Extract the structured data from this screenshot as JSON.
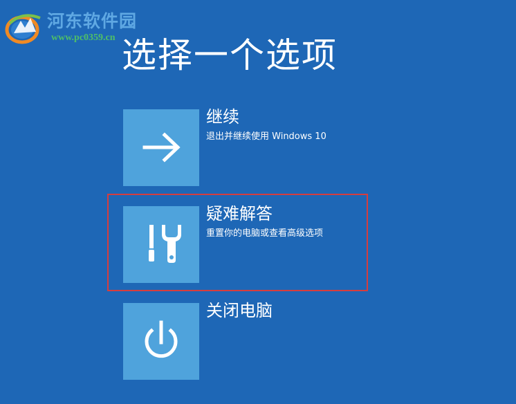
{
  "watermark": {
    "name": "河东软件园",
    "url": "www.pc0359.cn"
  },
  "screen": {
    "title": "选择一个选项"
  },
  "options": [
    {
      "id": "continue",
      "title": "继续",
      "description": "退出并继续使用 Windows 10",
      "icon": "arrow-right-icon"
    },
    {
      "id": "troubleshoot",
      "title": "疑难解答",
      "description": "重置你的电脑或查看高级选项",
      "icon": "tools-icon",
      "highlighted": true
    },
    {
      "id": "shutdown",
      "title": "关闭电脑",
      "description": "",
      "icon": "power-icon"
    }
  ],
  "colors": {
    "background": "#1e67b6",
    "tile": "#4fa3dc",
    "highlight_border": "#d73d3d",
    "text": "#ffffff",
    "watermark_name": "#5fa8e3",
    "watermark_url": "#4fbf67"
  }
}
